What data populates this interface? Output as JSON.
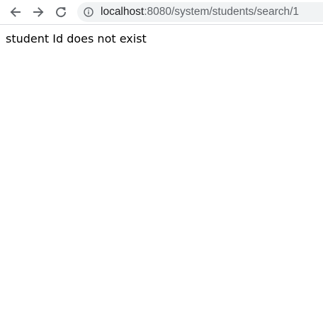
{
  "browser": {
    "url_host": "localhost",
    "url_rest": ":8080/system/students/search/1",
    "icons": {
      "back": "arrow-left-icon",
      "forward": "arrow-right-icon",
      "reload": "reload-icon",
      "site_info": "info-icon"
    },
    "colors": {
      "icon": "#5f6368",
      "omnibox_bg": "#f1f3f4",
      "host_text": "#202124",
      "path_text": "#5f6368"
    }
  },
  "page": {
    "message": "student Id does not exist"
  }
}
